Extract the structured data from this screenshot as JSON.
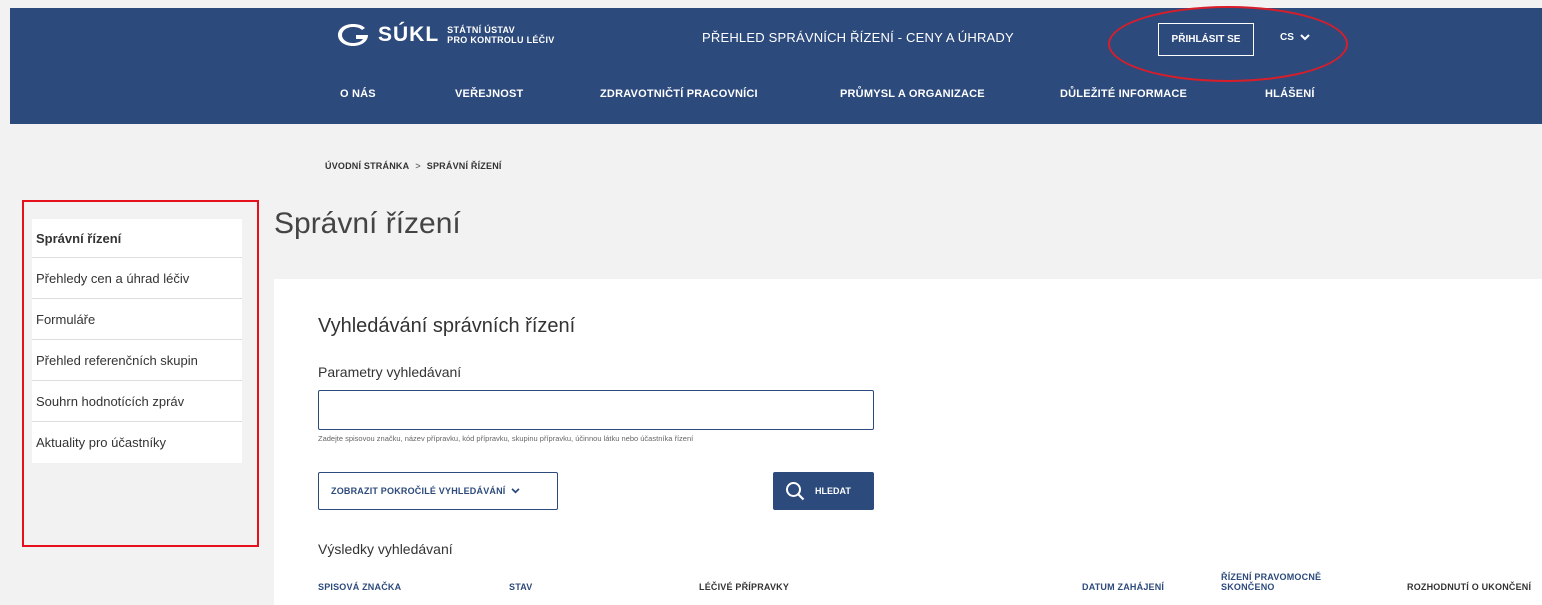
{
  "header": {
    "brand": "SÚKL",
    "brand_sub_line1": "STÁTNÍ ÚSTAV",
    "brand_sub_line2": "PRO KONTROLU LÉČIV",
    "site_title": "PŘEHLED SPRÁVNÍCH ŘÍZENÍ - CENY A ÚHRADY",
    "login_label": "PŘIHLÁSIT SE",
    "lang_label": "CS",
    "nav": [
      "O NÁS",
      "VEŘEJNOST",
      "ZDRAVOTNIČTÍ PRACOVNÍCI",
      "PRŮMYSL A ORGANIZACE",
      "DŮLEŽITÉ INFORMACE",
      "HLÁŠENÍ"
    ]
  },
  "breadcrumb": {
    "home": "ÚVODNÍ STRÁNKA",
    "separator": ">",
    "current": "SPRÁVNÍ ŘÍZENÍ"
  },
  "sidebar": {
    "items": [
      {
        "label": "Správní řízení"
      },
      {
        "label": "Přehledy cen a úhrad léčiv"
      },
      {
        "label": "Formuláře"
      },
      {
        "label": "Přehled referenčních skupin"
      },
      {
        "label": "Souhrn hodnotících zpráv"
      },
      {
        "label": "Aktuality pro účastníky"
      }
    ]
  },
  "main": {
    "page_title": "Správní řízení",
    "search_heading": "Vyhledávání správních řízení",
    "params_label": "Parametry vyhledávaní",
    "search_value": "",
    "hint": "Zadejte spisovou značku, název přípravku, kód přípravku, skupinu přípravku, účinnou látku nebo účastníka řízení",
    "advanced_label": "ZOBRAZIT POKROČILÉ VYHLEDÁVÁNÍ",
    "search_button": "HLEDAT",
    "results_label": "Výsledky vyhledávaní",
    "columns": [
      "SPISOVÁ ZNAČKA",
      "STAV",
      "LÉČIVÉ PŘÍPRAVKY",
      "DATUM ZAHÁJENÍ",
      "ŘÍZENÍ PRAVOMOCNĚ",
      "SKONČENO",
      "ROZHODNUTÍ O UKONČENÍ"
    ]
  },
  "colors": {
    "brand_blue": "#2c4a7c",
    "annotation_red": "#e5101c",
    "background": "#f2f2f2"
  }
}
